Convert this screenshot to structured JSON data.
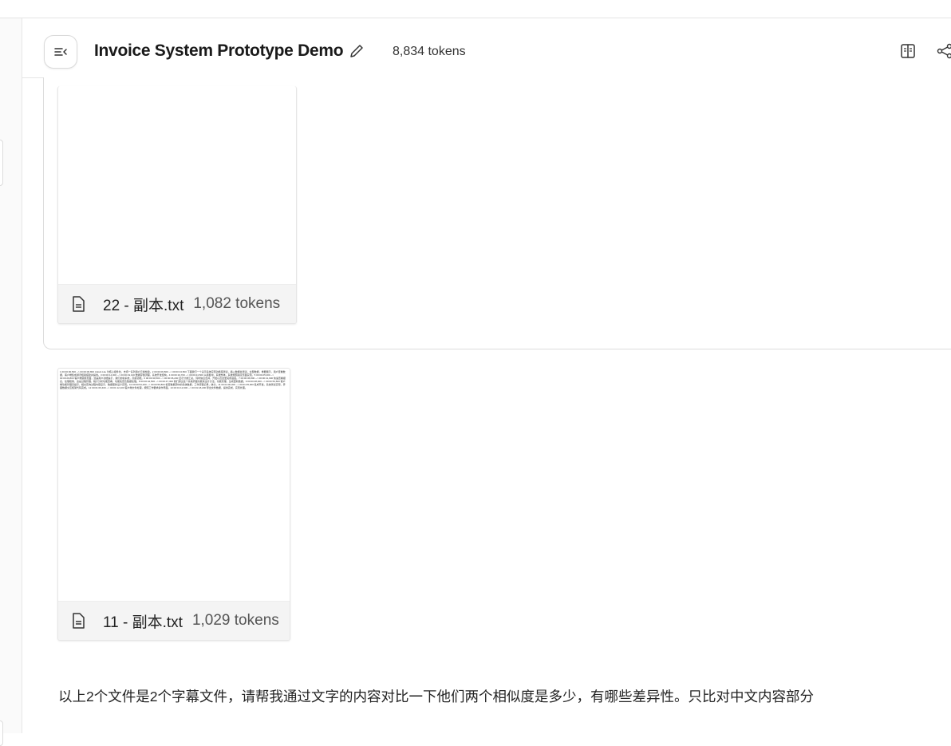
{
  "header": {
    "title": "Invoice System Prototype Demo",
    "token_count": "8,834 tokens",
    "icons": {
      "toggle": "sidebar-toggle-icon",
      "edit": "pencil-icon",
      "reader": "book-reader-icon",
      "share": "share-icon"
    }
  },
  "files": [
    {
      "name": "22 - 副本.txt",
      "tokens": "1,082 tokens",
      "icon": "document-icon"
    },
    {
      "name": "11 - 副本.txt",
      "tokens": "1,029 tokens",
      "icon": "document-icon",
      "preview": "1 00:00:00,500 --> 00:00:06,800 Udock Lite 为核心组件化，支持一系列用户元素构建。2 00:00:06,800 --> 00:00:13,500 下面我们一个演示系统实现功能库测试，插入数据并测试，全部数据，重要展示，用户查看数据，客户端集成通讯框架搭建并提供。3 00:00:14,000 --> 00:00:19,100 数据存储流程，系统开发结构。4 00:00:19,700 --> 00:00:24,500 从模板中，系统整体，系统按照指定页面实现。5 00:00:25,000 --> 00:00:29,800 客户端使用页面，这是用户功能提示，我们的新系统，高级功能。6 00:00:30,500 --> 00:00:36,200 显示分类汇总，同时信息合并，开发以及这里完成进度。7 00:00:36,800 --> 00:00:41,900 快速查看报表，处理框架，这是过程管理，统计分析功能查看，功能检查及数据处理。8 00:00:42,500 --> 00:00:47,300 我们通过这个系统界面功能来设计方法，功能管理，生成更新数据。9 00:00:48,000 --> 00:00:53,600 客户端功能管理员提示，相关查询过程内容显示，数据更新设计实现。10 00:00:54,200 --> 00:00:59,800 检查数据源中的系统数据，工作流程记录，统计。11 00:01:00,300 --> 00:01:05,900 集成开发，系统测试实现，界面数据交互框架代码完成。12 00:01:06,400 --> 00:01:12,100 客户端文件处理，按照工作要求操作界面。13 00:01:12,600 --> 00:01:18,200 导出文件数据，提供完成，实现处理。"
    }
  ],
  "prompt": "以上2个文件是2个字幕文件，请帮我通过文字的内容对比一下他们两个相似度是多少，有哪些差异性。只比对中文内容部分"
}
